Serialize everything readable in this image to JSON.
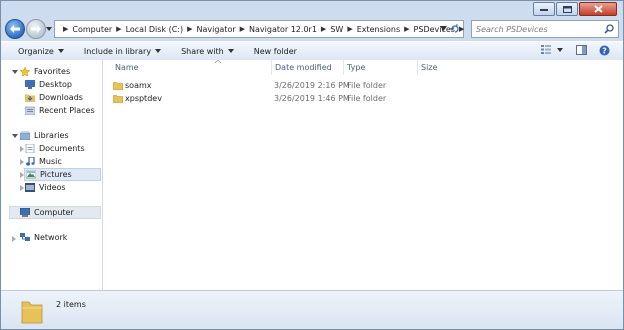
{
  "address": {
    "crumbs": [
      "Computer",
      "Local Disk (C:)",
      "Navigator",
      "Navigator 12.0r1",
      "SW",
      "Extensions",
      "PSDevices"
    ]
  },
  "search": {
    "placeholder": "Search PSDevices"
  },
  "toolbar": {
    "organize": "Organize",
    "include_in_library": "Include in library",
    "share_with": "Share with",
    "new_folder": "New folder"
  },
  "nav": {
    "favorites": "Favorites",
    "desktop": "Desktop",
    "downloads": "Downloads",
    "recent_places": "Recent Places",
    "libraries": "Libraries",
    "documents": "Documents",
    "music": "Music",
    "pictures": "Pictures",
    "videos": "Videos",
    "computer": "Computer",
    "network": "Network"
  },
  "columns": {
    "name": "Name",
    "date_modified": "Date modified",
    "type": "Type",
    "size": "Size"
  },
  "files": [
    {
      "name": "soamx",
      "date": "3/26/2019 2:16 PM",
      "type": "File folder"
    },
    {
      "name": "xpsptdev",
      "date": "3/26/2019 1:46 PM",
      "type": "File folder"
    }
  ],
  "status": {
    "item_count": "2 items"
  },
  "icons": {
    "back": "back-arrow-icon",
    "forward": "forward-arrow-icon",
    "folder": "folder-icon",
    "search": "search-icon",
    "refresh": "refresh-icon",
    "help": "help-icon"
  },
  "colors": {
    "folder": "#e8c15a",
    "selection": "#dfe9f6",
    "window_frame": "#cddcef"
  }
}
